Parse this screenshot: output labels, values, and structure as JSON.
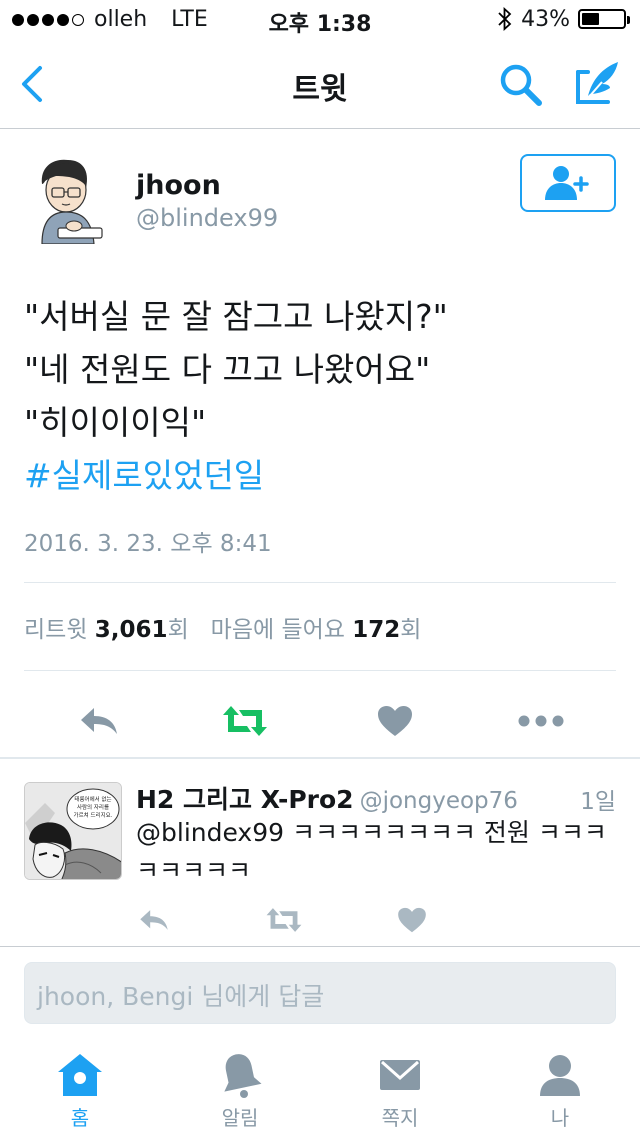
{
  "status_bar": {
    "carrier": "olleh",
    "network": "LTE",
    "time": "오후 1:38",
    "battery_text": "43%",
    "battery_level": 0.43
  },
  "nav": {
    "title": "트윗"
  },
  "tweet": {
    "user_name": "jhoon",
    "user_handle": "@blindex99",
    "lines": [
      "\"서버실 문 잘 잠그고 나왔지?\"",
      "\"네 전원도 다 끄고 나왔어요\"",
      "\"히이이이익\""
    ],
    "hashtag": "#실제로있었던일",
    "timestamp": "2016. 3. 23. 오후 8:41",
    "stats": {
      "retweet_label": "리트윗",
      "retweet_count": "3,061",
      "retweet_suffix": "회",
      "like_label": "마음에 들어요",
      "like_count": "172",
      "like_suffix": "회"
    }
  },
  "reply": {
    "user_name": "H2 그리고 X-Pro2",
    "user_handle": "@jongyeop76",
    "time": "1일",
    "text": "@blindex99 ㅋㅋㅋㅋㅋㅋㅋㅋ 전원 ㅋㅋㅋㅋㅋㅋㅋㅋ",
    "avatar_bubble_text": "태릉어에서 없는 사람의 자리를 가르쳐 드리지요."
  },
  "reply_box": {
    "placeholder": "jhoon, Bengi 님에게 답글"
  },
  "tabs": [
    {
      "label": "홈",
      "icon": "home-icon",
      "active": true
    },
    {
      "label": "알림",
      "icon": "bell-icon",
      "active": false
    },
    {
      "label": "쪽지",
      "icon": "envelope-icon",
      "active": false
    },
    {
      "label": "나",
      "icon": "person-icon",
      "active": false
    }
  ],
  "colors": {
    "accent": "#1da1f2",
    "retweet_active": "#17bf63",
    "muted": "#8899a6",
    "icon_gray": "#aab8c2"
  }
}
